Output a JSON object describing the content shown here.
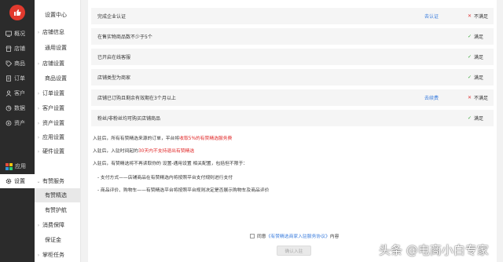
{
  "nav1": {
    "items": [
      {
        "label": "概况",
        "icon": "overview-icon"
      },
      {
        "label": "店铺",
        "icon": "store-icon"
      },
      {
        "label": "商品",
        "icon": "tag-icon"
      },
      {
        "label": "订单",
        "icon": "order-icon"
      },
      {
        "label": "客户",
        "icon": "customer-icon"
      },
      {
        "label": "数据",
        "icon": "chart-icon"
      },
      {
        "label": "资产",
        "icon": "asset-icon"
      },
      {
        "label": "应用",
        "icon": "apps-icon"
      },
      {
        "label": "设置",
        "icon": "gear-icon"
      }
    ]
  },
  "nav2": {
    "items": [
      {
        "label": "设置中心"
      },
      {
        "label": "店铺信息"
      },
      {
        "label": "通用设置"
      },
      {
        "label": "店铺设置"
      },
      {
        "label": "商品设置"
      },
      {
        "label": "订单设置"
      },
      {
        "label": "客户设置"
      },
      {
        "label": "资产设置"
      },
      {
        "label": "应用设置"
      },
      {
        "label": "硬件设置"
      },
      {
        "label": "有赞服务"
      },
      {
        "label": "有赞精选"
      },
      {
        "label": "有赞护航"
      },
      {
        "label": "消费保障"
      },
      {
        "label": "保证金"
      },
      {
        "label": "掌柜任务"
      }
    ]
  },
  "requirements": [
    {
      "text": "完成企业认证",
      "action": "去认证",
      "status": "不满足",
      "met": false
    },
    {
      "text": "在售实物商品数不少于5个",
      "action": "",
      "status": "满足",
      "met": true
    },
    {
      "text": "已开启在线客服",
      "action": "",
      "status": "满足",
      "met": true
    },
    {
      "text": "店铺类型为商家",
      "action": "",
      "status": "满足",
      "met": true
    },
    {
      "text": "店铺已订购且剩余有效期在3个月以上",
      "action": "去续费",
      "status": "不满足",
      "met": false
    },
    {
      "text": "粉丝/非粉丝均可购买店铺商品",
      "action": "",
      "status": "满足",
      "met": true
    }
  ],
  "notes": {
    "n1_pre": "入驻后，所有有赞精选来源的订单，平台将",
    "n1_red": "收取5%的有赞精选服务费",
    "n2_pre": "入驻后，入驻时间起的",
    "n2_red": "30天内不支持退出有赞精选",
    "n3": "入驻后，有赞精选将不再读取你的 设置-通用设置 相关配置，包括但不限于：",
    "n4": "- 支付方式——店铺商品在有赞精选内将按照平台支付规则进行支付",
    "n5": "- 商品评价、购物车——有赞精选平台将按照平台规则决定是否展示购物车及商品评价"
  },
  "agree": {
    "pre": "同意",
    "link": "《有赞精选商家入驻服务协议》",
    "post": "内容"
  },
  "confirm_button": "确认入驻",
  "watermark": "头条 @电商小白专家",
  "colors": {
    "accent_red": "#e02525",
    "link_blue": "#3b7ddd",
    "ok_green": "#35a335"
  }
}
